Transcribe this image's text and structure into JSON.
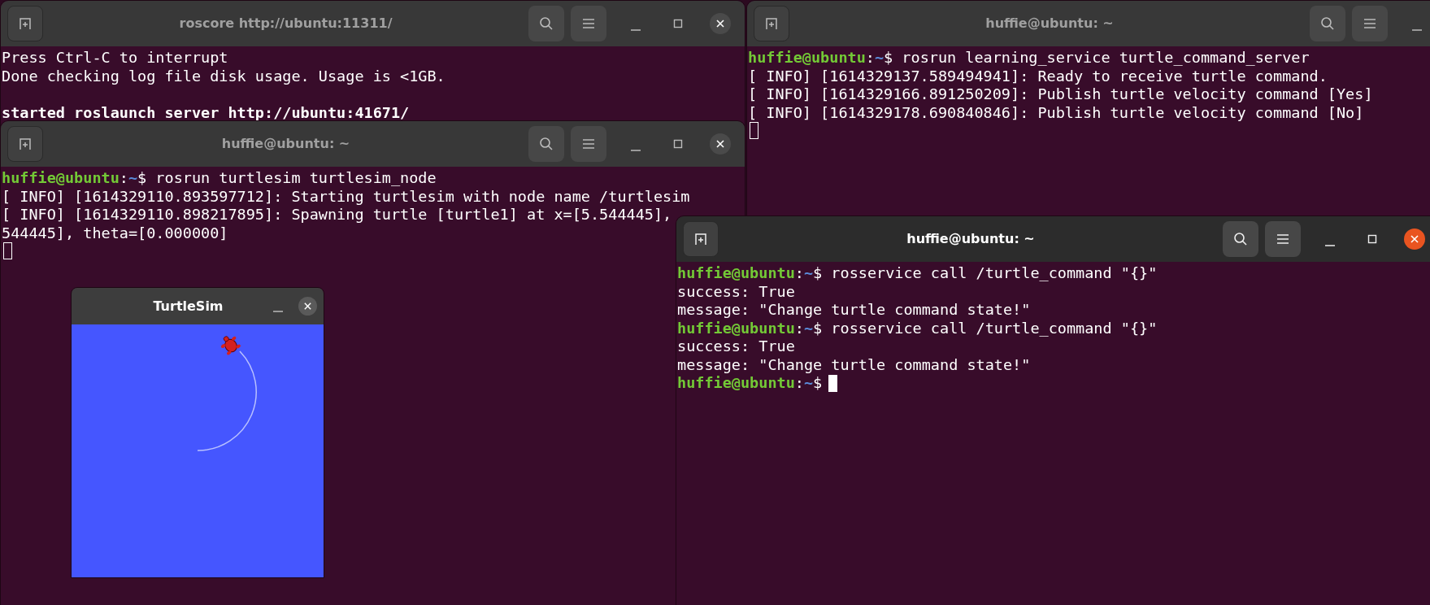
{
  "windows": [
    {
      "kind": "terminal",
      "title": "roscore http://ubuntu:11311/",
      "focused": false,
      "lines": [
        {
          "kind": "output",
          "text": "Press Ctrl-C to interrupt"
        },
        {
          "kind": "output",
          "text": "Done checking log file disk usage. Usage is <1GB."
        },
        {
          "kind": "blank"
        },
        {
          "kind": "bold",
          "text": "started roslaunch server http://ubuntu:41671/"
        }
      ]
    },
    {
      "kind": "terminal",
      "title": "huffie@ubuntu: ~",
      "focused": false,
      "cursor": true,
      "lines": [
        {
          "kind": "prompt",
          "user": "huffie@ubuntu",
          "sep": ":",
          "path": "~",
          "symbol": "$",
          "command": "rosrun learning_service turtle_command_server"
        },
        {
          "kind": "output",
          "text": "[ INFO] [1614329137.589494941]: Ready to receive turtle command."
        },
        {
          "kind": "output",
          "text": "[ INFO] [1614329166.891250209]: Publish turtle velocity command [Yes]"
        },
        {
          "kind": "output",
          "text": "[ INFO] [1614329178.690840846]: Publish turtle velocity command [No]"
        }
      ]
    },
    {
      "kind": "terminal",
      "title": "huffie@ubuntu: ~",
      "focused": false,
      "cursor": true,
      "lines": [
        {
          "kind": "prompt",
          "user": "huffie@ubuntu",
          "sep": ":",
          "path": "~",
          "symbol": "$",
          "command": "rosrun turtlesim turtlesim_node"
        },
        {
          "kind": "output",
          "text": "[ INFO] [1614329110.893597712]: Starting turtlesim with node name /turtlesim"
        },
        {
          "kind": "output",
          "text": "[ INFO] [1614329110.898217895]: Spawning turtle [turtle1] at x=[5.544445],"
        },
        {
          "kind": "output",
          "text": "544445], theta=[0.000000]"
        }
      ]
    },
    {
      "kind": "turtlesim",
      "title": "TurtleSim",
      "focused": false
    },
    {
      "kind": "terminal",
      "title": "huffie@ubuntu: ~",
      "focused": true,
      "cursor": true,
      "lines": [
        {
          "kind": "prompt",
          "user": "huffie@ubuntu",
          "sep": ":",
          "path": "~",
          "symbol": "$",
          "command": "rosservice call /turtle_command \"{}\""
        },
        {
          "kind": "output",
          "text": "success: True"
        },
        {
          "kind": "output",
          "text": "message: \"Change turtle command state!\""
        },
        {
          "kind": "prompt",
          "user": "huffie@ubuntu",
          "sep": ":",
          "path": "~",
          "symbol": "$",
          "command": "rosservice call /turtle_command \"{}\""
        },
        {
          "kind": "output",
          "text": "success: True"
        },
        {
          "kind": "output",
          "text": "message: \"Change turtle command state!\""
        },
        {
          "kind": "prompt",
          "user": "huffie@ubuntu",
          "sep": ":",
          "path": "~",
          "symbol": "$"
        }
      ]
    }
  ]
}
